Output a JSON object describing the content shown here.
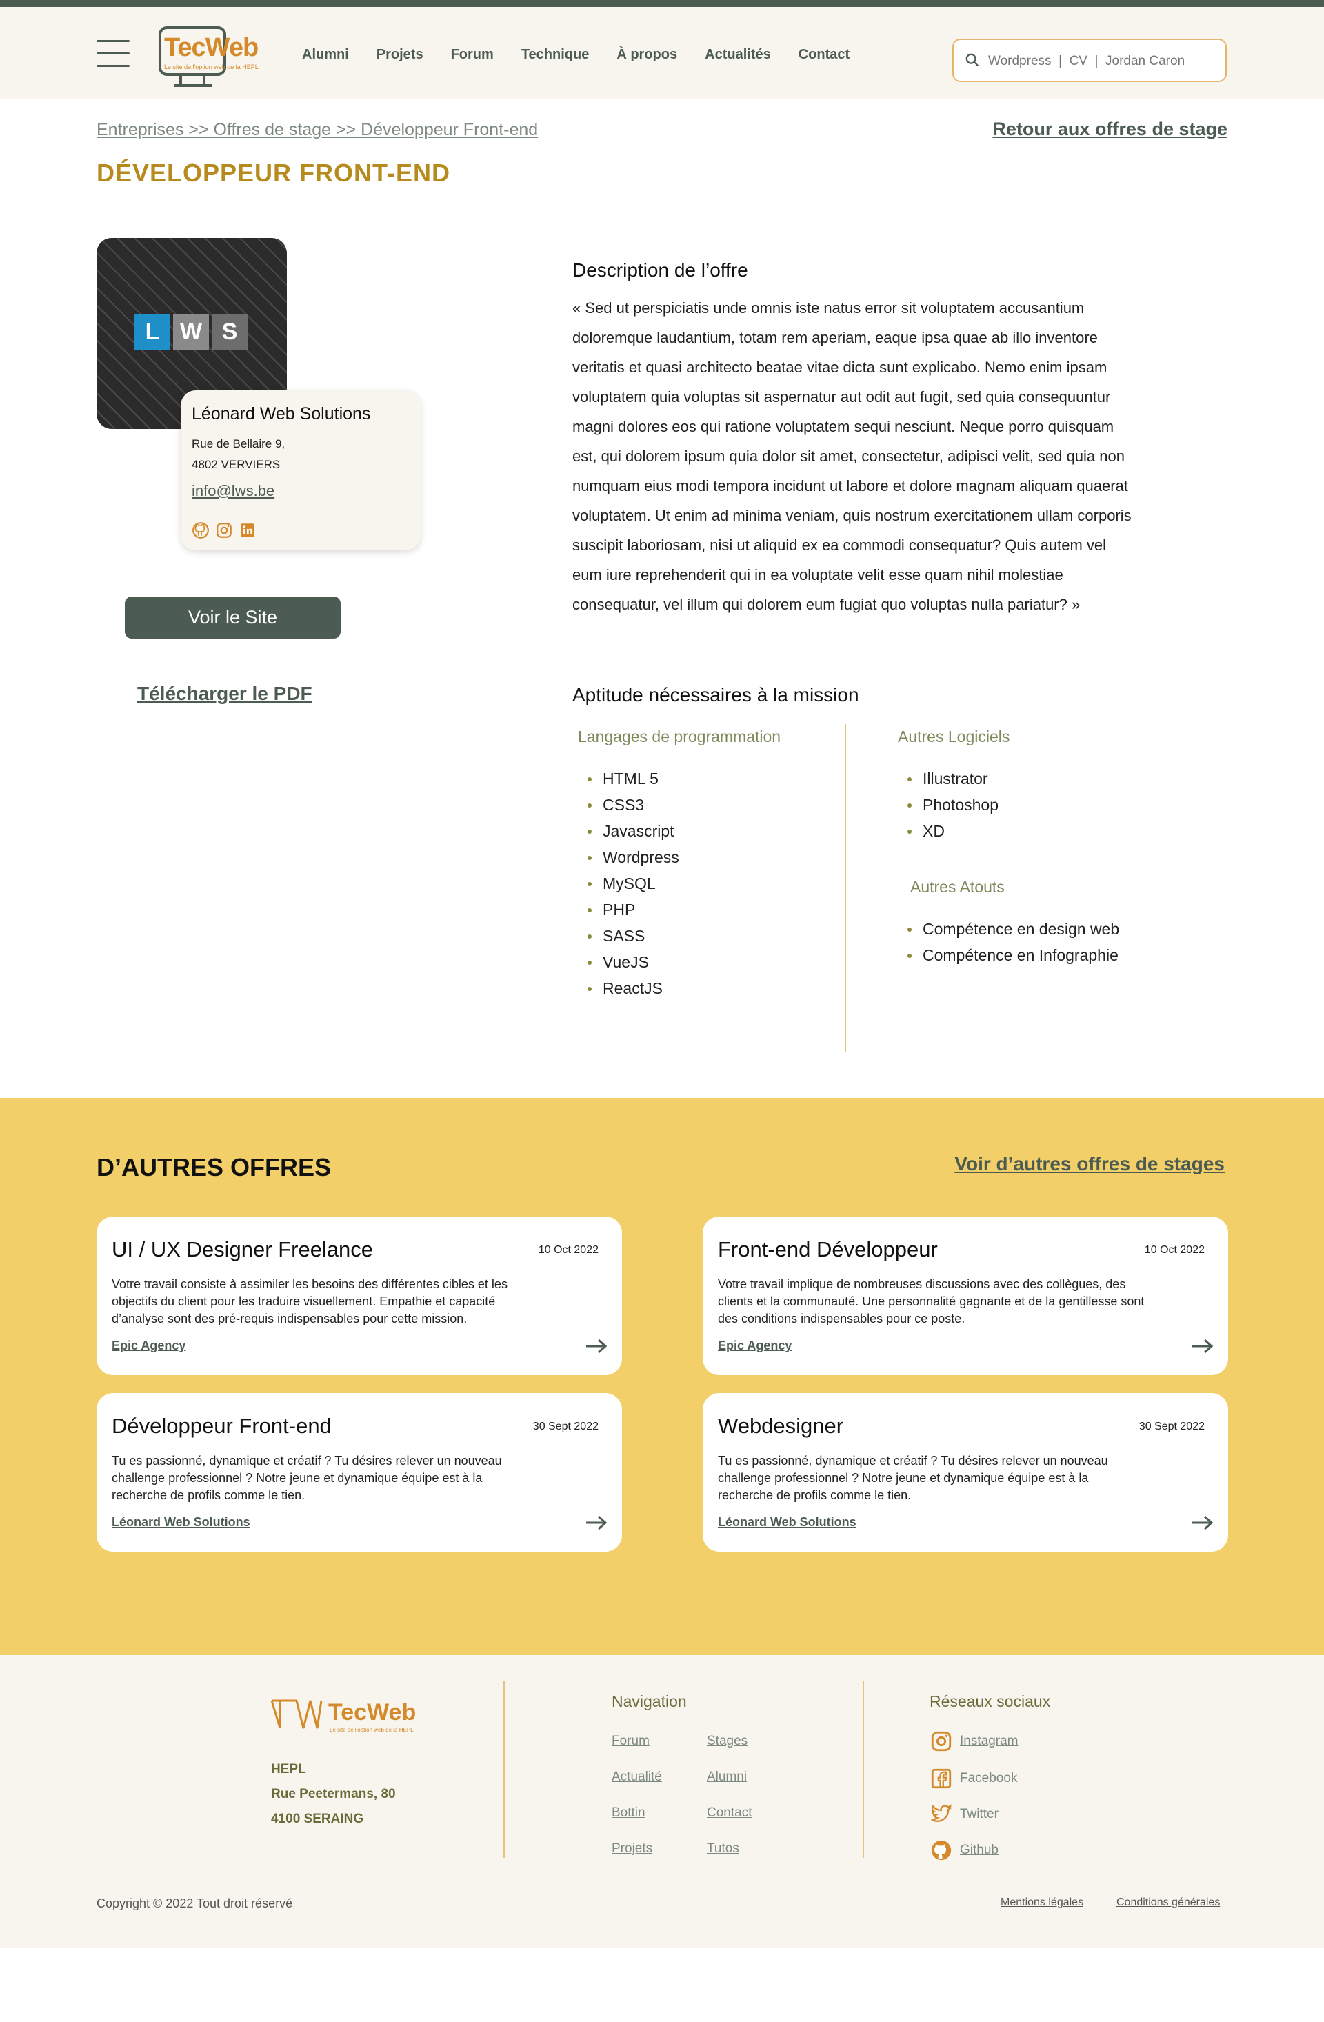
{
  "header": {
    "logo_name": "TecWeb",
    "logo_tagline": "Le site de l'option web de la HEPL",
    "nav": [
      "Alumni",
      "Projets",
      "Forum",
      "Technique",
      "À propos",
      "Actualités",
      "Contact"
    ],
    "search_placeholder": "Wordpress  |  CV  |  Jordan Caron"
  },
  "breadcrumb": "Entreprises >> Offres de stage >> Développeur Front-end",
  "back_link": "Retour aux offres de stage",
  "page_title": "DÉVELOPPEUR FRONT-END",
  "company": {
    "logo_letters": [
      "L",
      "W",
      "S"
    ],
    "logo_colors": [
      "#1e8fc8",
      "#8a8a8a",
      "#6d6d6d"
    ],
    "name": "Léonard Web Solutions",
    "address_line1": "Rue de Bellaire 9,",
    "address_line2": "4802 VERVIERS",
    "email": "info@lws.be",
    "social_icons": [
      "github-icon",
      "instagram-icon",
      "linkedin-icon"
    ]
  },
  "buttons": {
    "visit_site": "Voir le Site",
    "download_pdf": "Télécharger le PDF"
  },
  "description": {
    "heading": "Description de l’offre",
    "text": "« Sed ut perspiciatis unde omnis iste natus error sit voluptatem accusantium doloremque laudantium, totam rem aperiam, eaque ipsa quae ab illo inventore veritatis et quasi architecto beatae vitae dicta sunt explicabo. Nemo enim ipsam voluptatem quia voluptas sit aspernatur aut odit aut fugit, sed quia consequuntur magni dolores eos qui ratione voluptatem sequi nesciunt. Neque porro quisquam est, qui dolorem ipsum quia dolor sit amet, consectetur, adipisci velit, sed quia non numquam eius modi tempora incidunt ut labore et dolore magnam aliquam quaerat voluptatem. Ut enim ad minima veniam, quis nostrum exercitationem ullam corporis suscipit laboriosam, nisi ut aliquid ex ea commodi consequatur? Quis autem vel eum iure reprehenderit qui in ea voluptate velit esse quam nihil molestiae consequatur, vel illum qui dolorem eum fugiat quo voluptas nulla pariatur? »"
  },
  "skills": {
    "heading": "Aptitude nécessaires à la mission",
    "languages_title": "Langages de programmation",
    "languages": [
      "HTML 5",
      "CSS3",
      "Javascript",
      "Wordpress",
      "MySQL",
      "PHP",
      "SASS",
      "VueJS",
      "ReactJS"
    ],
    "software_title": "Autres Logiciels",
    "software": [
      "Illustrator",
      "Photoshop",
      "XD"
    ],
    "assets_title": "Autres Atouts",
    "assets": [
      "Compétence en design web",
      "Compétence en Infographie"
    ]
  },
  "other_offers": {
    "title": "D’AUTRES OFFRES",
    "more_link": "Voir d’autres offres de stages",
    "items": [
      {
        "title": "UI / UX Designer Freelance",
        "date": "10 Oct 2022",
        "text": "Votre travail consiste à assimiler les besoins des différentes cibles et les objectifs du client pour les traduire visuellement. Empathie et capacité d’analyse sont des pré-requis indispensables pour cette mission.",
        "company": "Epic Agency"
      },
      {
        "title": "Front-end Développeur",
        "date": "10 Oct 2022",
        "text": "Votre travail implique de nombreuses discussions avec des collègues, des clients et la communauté. Une personnalité gagnante et de la gentillesse sont des conditions indispensables pour ce poste.",
        "company": "Epic Agency"
      },
      {
        "title": "Développeur Front-end",
        "date": "30 Sept 2022",
        "text": "Tu es passionné, dynamique et créatif ? Tu désires relever un nouveau challenge professionnel ? Notre jeune et dynamique équipe est à la recherche de profils comme le tien.",
        "company": "Léonard Web Solutions"
      },
      {
        "title": "Webdesigner",
        "date": "30 Sept 2022",
        "text": "Tu es passionné, dynamique et créatif ? Tu désires relever un nouveau challenge professionnel ? Notre jeune et dynamique équipe est à la recherche de profils comme le tien.",
        "company": "Léonard Web Solutions"
      }
    ]
  },
  "footer": {
    "logo_name": "TecWeb",
    "logo_tagline": "Le site de l'option web de la HEPL",
    "address": [
      "HEPL",
      "Rue Peetermans, 80",
      "4100 SERAING"
    ],
    "nav_title": "Navigation",
    "nav_col1": [
      "Forum",
      "Actualité",
      "Bottin",
      "Projets"
    ],
    "nav_col2": [
      "Stages",
      "Alumni",
      "Contact",
      "Tutos"
    ],
    "social_title": "Réseaux sociaux",
    "social": [
      "Instagram",
      "Facebook",
      "Twitter",
      "Github"
    ],
    "copyright": "Copyright © 2022 Tout droit réservé",
    "legal": "Mentions légales",
    "terms": "Conditions générales"
  },
  "colors": {
    "accent": "#4d5c52",
    "gold": "#b68a1d",
    "orange": "#d4892a",
    "yellow": "#f2cf68",
    "cream": "#f7f5ee"
  }
}
